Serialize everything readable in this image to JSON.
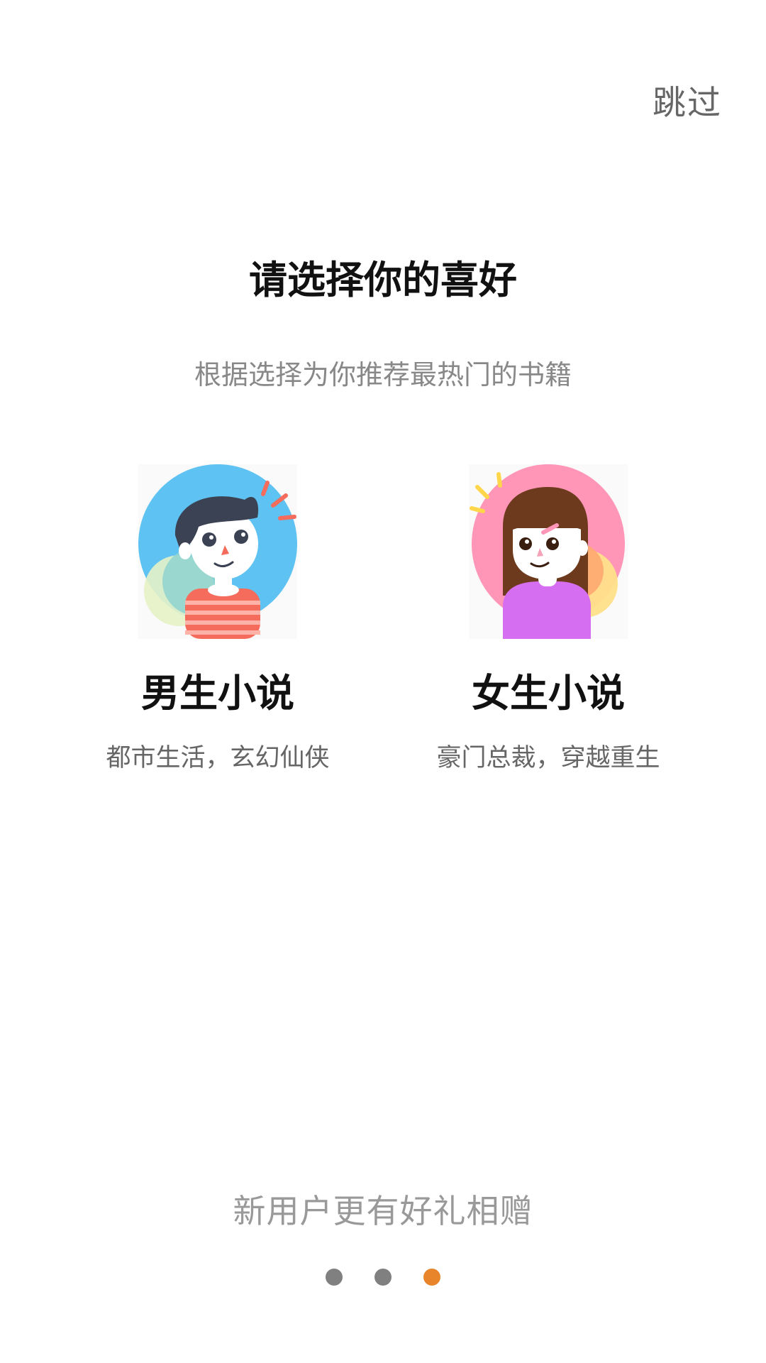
{
  "skip_label": "跳过",
  "title": "请选择你的喜好",
  "subtitle": "根据选择为你推荐最热门的书籍",
  "options": [
    {
      "title": "男生小说",
      "desc": "都市生活，玄幻仙侠",
      "icon": "boy-avatar-icon"
    },
    {
      "title": "女生小说",
      "desc": "豪门总裁，穿越重生",
      "icon": "girl-avatar-icon"
    }
  ],
  "promo": "新用户更有好礼相赠",
  "pagination": {
    "total": 3,
    "current": 3,
    "active_color": "#e8852a",
    "inactive_color": "#808080"
  }
}
